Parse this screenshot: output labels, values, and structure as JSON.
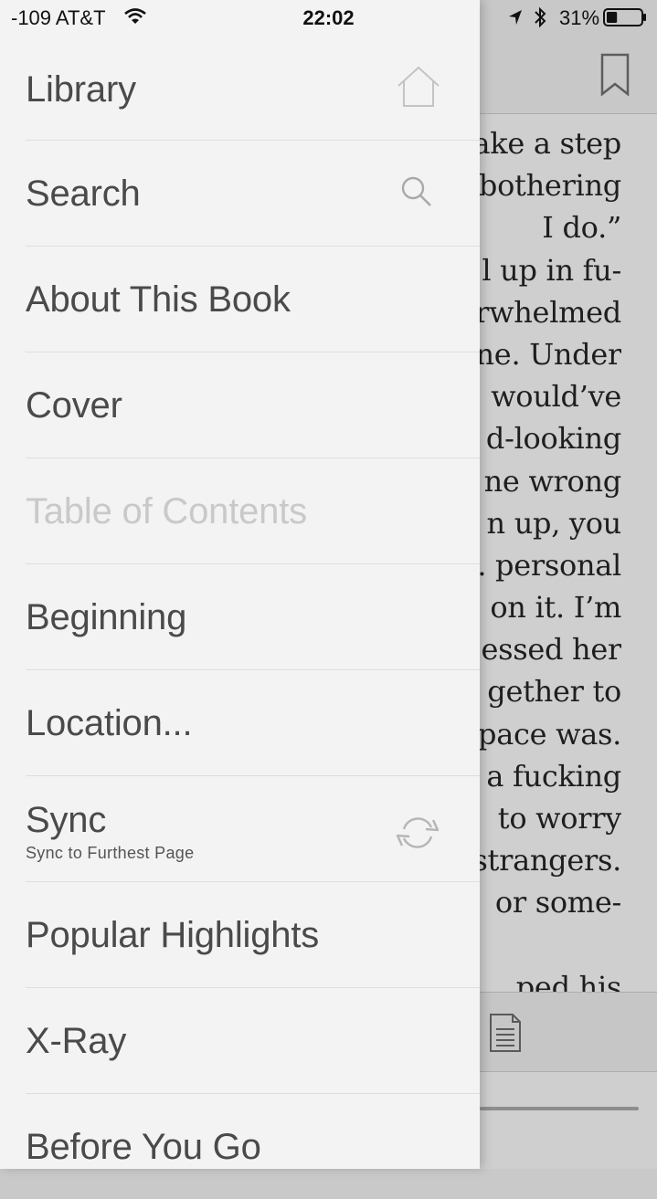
{
  "status_bar": {
    "carrier": "-109 AT&T",
    "time": "22:02",
    "battery_percent": "31%",
    "battery_level": 0.31
  },
  "drawer": {
    "items": [
      {
        "label": "Library",
        "icon": "home-icon"
      },
      {
        "label": "Search",
        "icon": "search-icon"
      },
      {
        "label": "About This Book"
      },
      {
        "label": "Cover"
      },
      {
        "label": "Table of Contents",
        "disabled": true
      },
      {
        "label": "Beginning"
      },
      {
        "label": "Location..."
      },
      {
        "label": "Sync",
        "sublabel": "Sync to Furthest Page",
        "icon": "sync-icon"
      },
      {
        "label": "Popular Highlights"
      },
      {
        "label": "X-Ray"
      },
      {
        "label": "Before You Go"
      }
    ]
  },
  "reader": {
    "lines": [
      "ake a step",
      "bothering",
      "I do.”",
      "l up in fu-",
      "rwhelmed",
      "ne. Under",
      "would’ve",
      "d-looking",
      "ne wrong",
      "n up, you",
      ". personal",
      "on it. I’m",
      "essed her",
      "gether to",
      "pace was.",
      "a fucking",
      "to worry",
      "strangers.",
      "or some-",
      "",
      "ped his"
    ]
  }
}
